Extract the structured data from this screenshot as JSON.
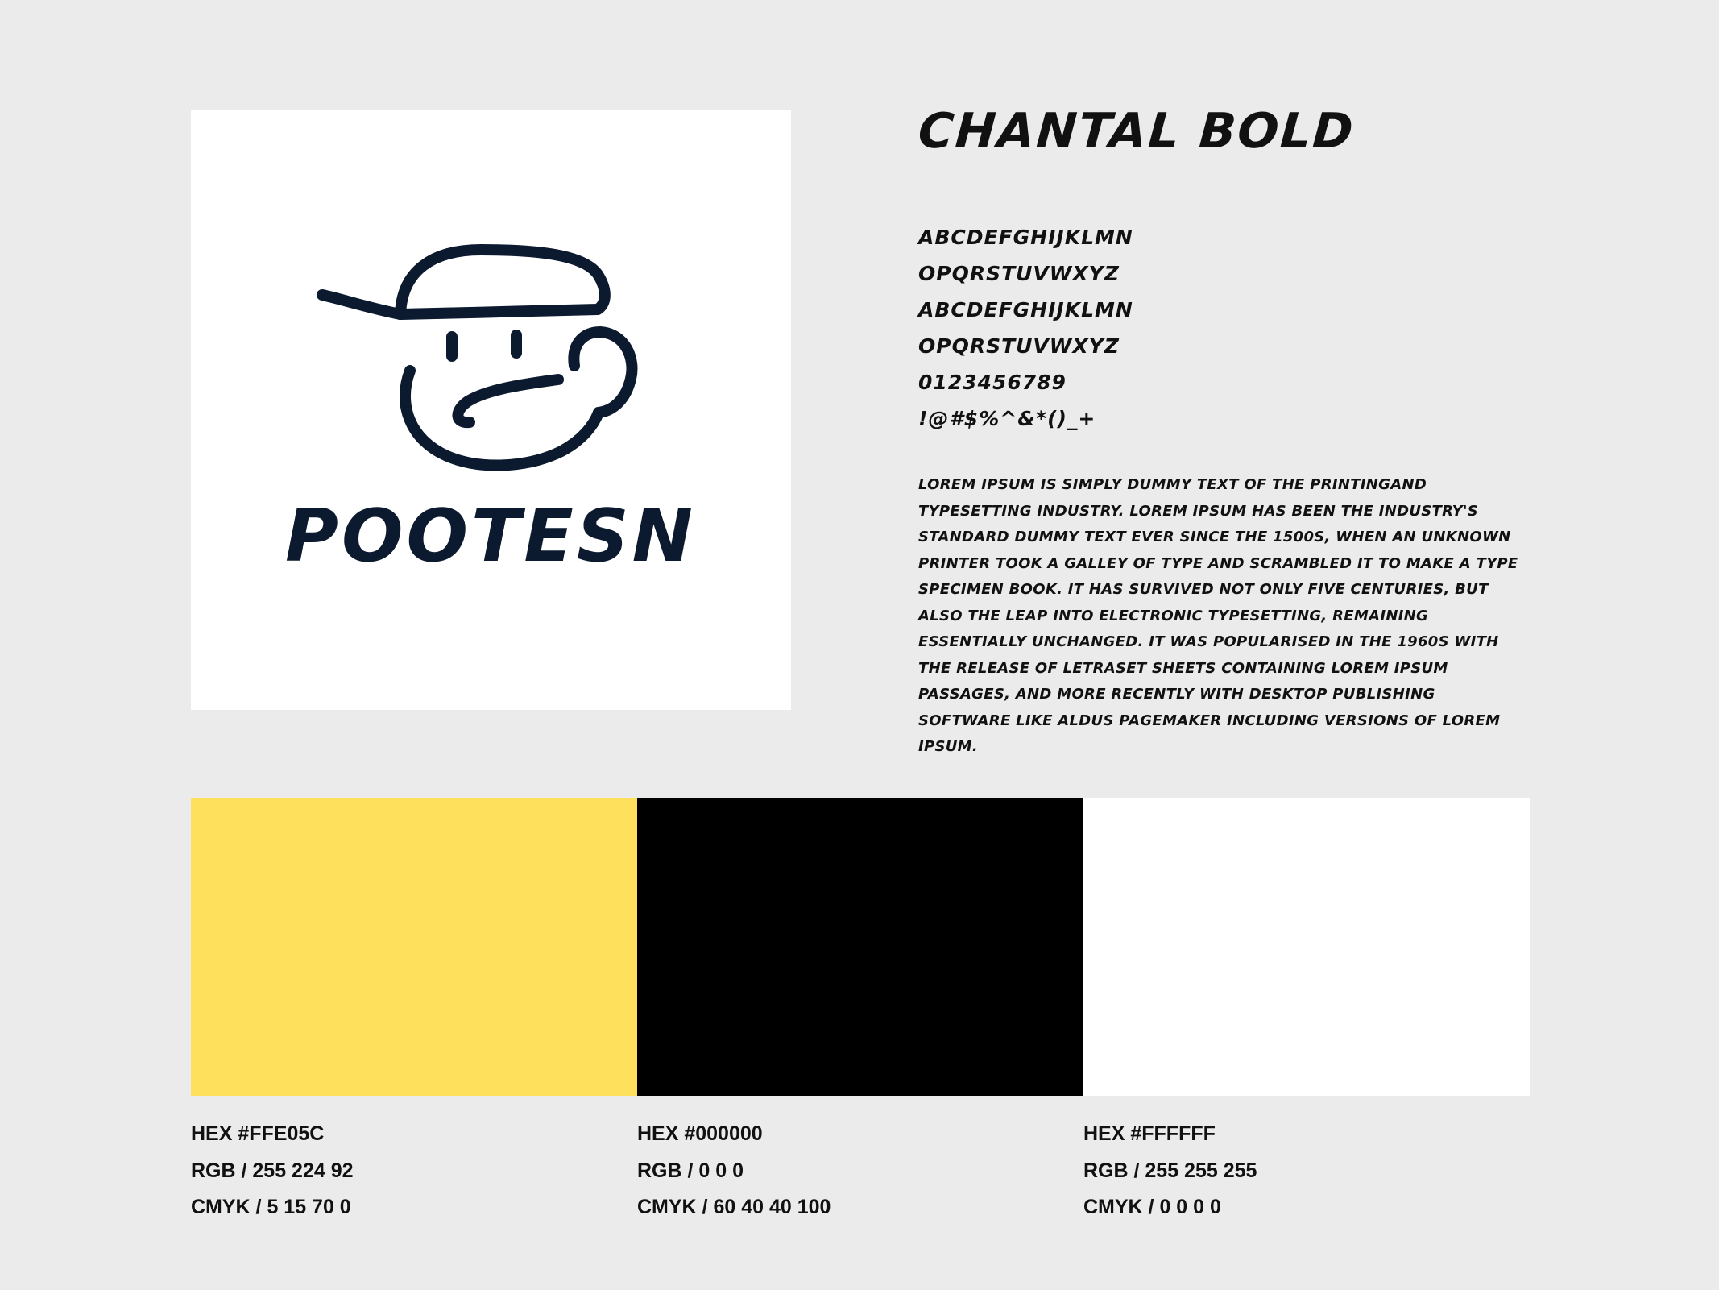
{
  "logo": {
    "wordmark": "POOTESN",
    "icon": "cap-face-mascot-icon",
    "ink_color": "#0b1a2e",
    "background": "#ffffff"
  },
  "typography": {
    "font_name": "CHANTAL BOLD",
    "glyph_lines": [
      "ABCDEFGHIJKLMN",
      "OPQRSTUVWXYZ",
      "ABCDEFGHIJKLMN",
      "OPQRSTUVWXYZ",
      "0123456789",
      "!@#$%^&*()_+"
    ],
    "sample_text": "Lorem Ipsum is simply dummy text of the printingand typesetting industry. Lorem Ipsum has been the industry's standard dummy text ever since the 1500s, when an unknown printer took a galley of type and scrambled it to make a type specimen book. It has survived not only five centuries, but also the leap into electronic typesetting, remaining essentially unchanged. It was popularised in the 1960s with the release of Letraset sheets containing Lorem Ipsum passages, and more recently with desktop publishing software like Aldus PageMaker including versions of Lorem Ipsum."
  },
  "palette": [
    {
      "color": "#FFE05C",
      "hex": "HEX #FFE05C",
      "rgb": "RGB / 255 224 92",
      "cmyk": "CMYK / 5 15 70 0"
    },
    {
      "color": "#000000",
      "hex": "HEX #000000",
      "rgb": "RGB / 0 0 0",
      "cmyk": "CMYK / 60 40 40 100"
    },
    {
      "color": "#FFFFFF",
      "hex": "HEX #FFFFFF",
      "rgb": "RGB / 255 255 255",
      "cmyk": "CMYK / 0 0 0 0"
    }
  ]
}
